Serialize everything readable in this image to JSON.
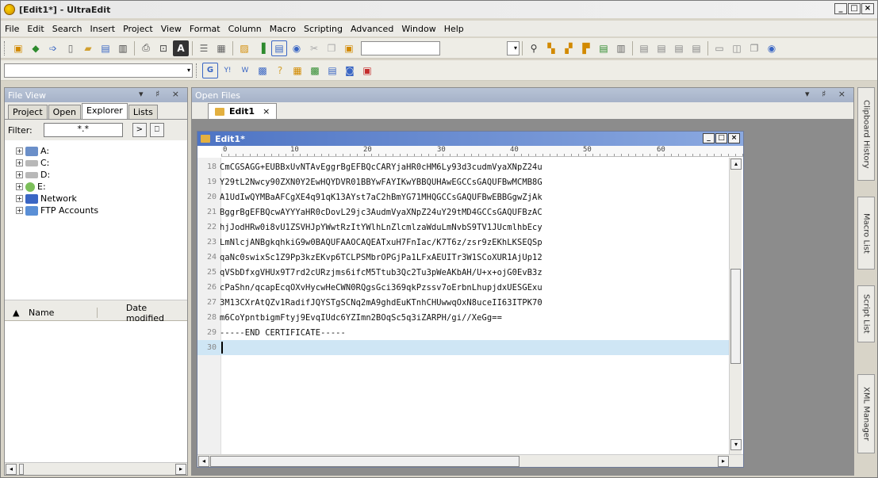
{
  "window": {
    "title": "[Edit1*] - UltraEdit",
    "controls": [
      "_",
      "□",
      "×"
    ]
  },
  "menu": [
    "File",
    "Edit",
    "Search",
    "Insert",
    "Project",
    "View",
    "Format",
    "Column",
    "Macro",
    "Scripting",
    "Advanced",
    "Window",
    "Help"
  ],
  "file_view": {
    "header": "File View",
    "header_controls": "▾ ♯ ×",
    "tabs": [
      "Project",
      "Open",
      "Explorer",
      "Lists"
    ],
    "active_tab": "Explorer",
    "filter_label": "Filter:",
    "filter_value": "*.*",
    "tree": [
      "A:",
      "C:",
      "D:",
      "E:",
      "Network",
      "FTP Accounts"
    ],
    "list_columns": [
      "Name",
      "Date modified"
    ]
  },
  "open_files": {
    "header": "Open Files",
    "header_controls": "▾ ♯ ×",
    "tab_label": "Edit1",
    "tab_close": "×"
  },
  "editor": {
    "title": "Edit1*",
    "ruler_marks": [
      "0",
      "10",
      "20",
      "30",
      "40",
      "50",
      "60"
    ],
    "lines": [
      {
        "num": "18",
        "text": "CmCGSAGG+EUBBxUvNTAvEggrBgEFBQcCARYjaHR0cHM6Ly93d3cudmVyaXNpZ24u"
      },
      {
        "num": "19",
        "text": "Y29tL2Nwcy90ZXN0Y2EwHQYDVR01BBYwFAYIKwYBBQUHAwEGCCsGAQUFBwMCMB8G"
      },
      {
        "num": "20",
        "text": "A1UdIwQYMBaAFCgXE4q91qK13AYst7aC2hBmYG71MHQGCCsGAQUFBwEBBGgwZjAk"
      },
      {
        "num": "21",
        "text": "BggrBgEFBQcwAYYYaHR0cDovL29jc3AudmVyaXNpZ24uY29tMD4GCCsGAQUFBzAC"
      },
      {
        "num": "22",
        "text": "hjJodHRw0i8vU1ZSVHJpYWwtRzItYWlhLnZlcmlzaWduLmNvbS9TV1JUcmlhbEcy"
      },
      {
        "num": "23",
        "text": "LmNlcjANBgkqhkiG9w0BAQUFAAOCAQEATxuH7FnIac/K7T6z/zsr9zEKhLKSEQSp"
      },
      {
        "num": "24",
        "text": "qaNc0swixSc1Z9Pp3kzEKvp6TCLPSMbrOPGjPa1LFxAEUITr3W1SCoXUR1AjUp12"
      },
      {
        "num": "25",
        "text": "qVSbDfxgVHUx9T7rd2cURzjms6ifcM5Ttub3Qc2Tu3pWeAKbAH/U+x+ojG0EvB3z"
      },
      {
        "num": "26",
        "text": "cPaShn/qcapEcqOXvHycwHeCWN0RQgsGci369qkPzssv7oErbnLhupjdxUESGExu"
      },
      {
        "num": "27",
        "text": "3M13CXrAtQZv1RadifJQYSTgSCNq2mA9ghdEuKTnhCHUwwqOxN8uceII63ITPK70"
      },
      {
        "num": "28",
        "text": "m6CoYpntbigmFtyj9EvqIUdc6YZImn2BOqSc5q3iZARPH/gi//XeGg=="
      },
      {
        "num": "29",
        "text": "-----END CERTIFICATE-----"
      },
      {
        "num": "30",
        "text": ""
      }
    ]
  },
  "side_panels": [
    "Clipboard History",
    "Macro List",
    "Script List",
    "XML Manager"
  ]
}
